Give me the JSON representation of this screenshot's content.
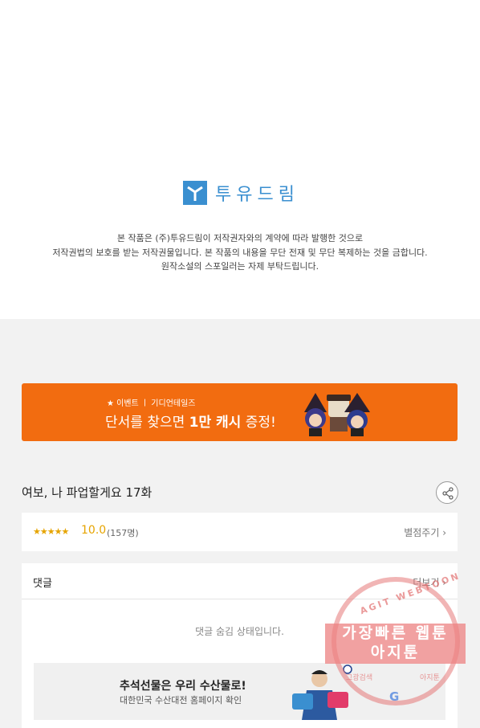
{
  "publisher": {
    "logo_text": "투유드림",
    "notice_lines": [
      "본 작품은 (주)투유드림이 저작권자와의 계약에 따라 발행한 것으로",
      "저작권법의 보호를 받는 저작권물입니다. 본 작품의 내용을 무단 전재 및 무단 복제하는 것을 금합니다.",
      "원작소설의 스포일러는 자제 부탁드립니다."
    ]
  },
  "event_banner": {
    "subtitle": "★ 이벤트 ㅣ 기디언테일즈",
    "title_pre": "단서를 찾으면 ",
    "title_bold": "1만 캐시",
    "title_post": " 증정!"
  },
  "episode": {
    "title": "여보, 나 파업할게요 17화",
    "share_icon": "share-icon"
  },
  "rating": {
    "stars": "★★★★★",
    "score": "10.0",
    "count": "(157명)",
    "rate_label": "별점주기 ›"
  },
  "comments": {
    "title": "댓글",
    "more_label": "더보기 ›",
    "hidden_message": "댓글 숨김 상태입니다."
  },
  "ad": {
    "title": "추석선물은 우리 수산물로!",
    "subtitle": "대한민국 수산대전 홈페이지 확인"
  },
  "watermark": {
    "top_text": "AGIT WEBTOON",
    "line1": "가장빠른 웹툰",
    "line2": "아지툰",
    "left_text": "그광검색",
    "right_text": "아지툰",
    "google": "G"
  },
  "colors": {
    "brand_blue": "#3a8fd0",
    "banner_orange": "#f26c10",
    "star_gold": "#e6a400"
  }
}
